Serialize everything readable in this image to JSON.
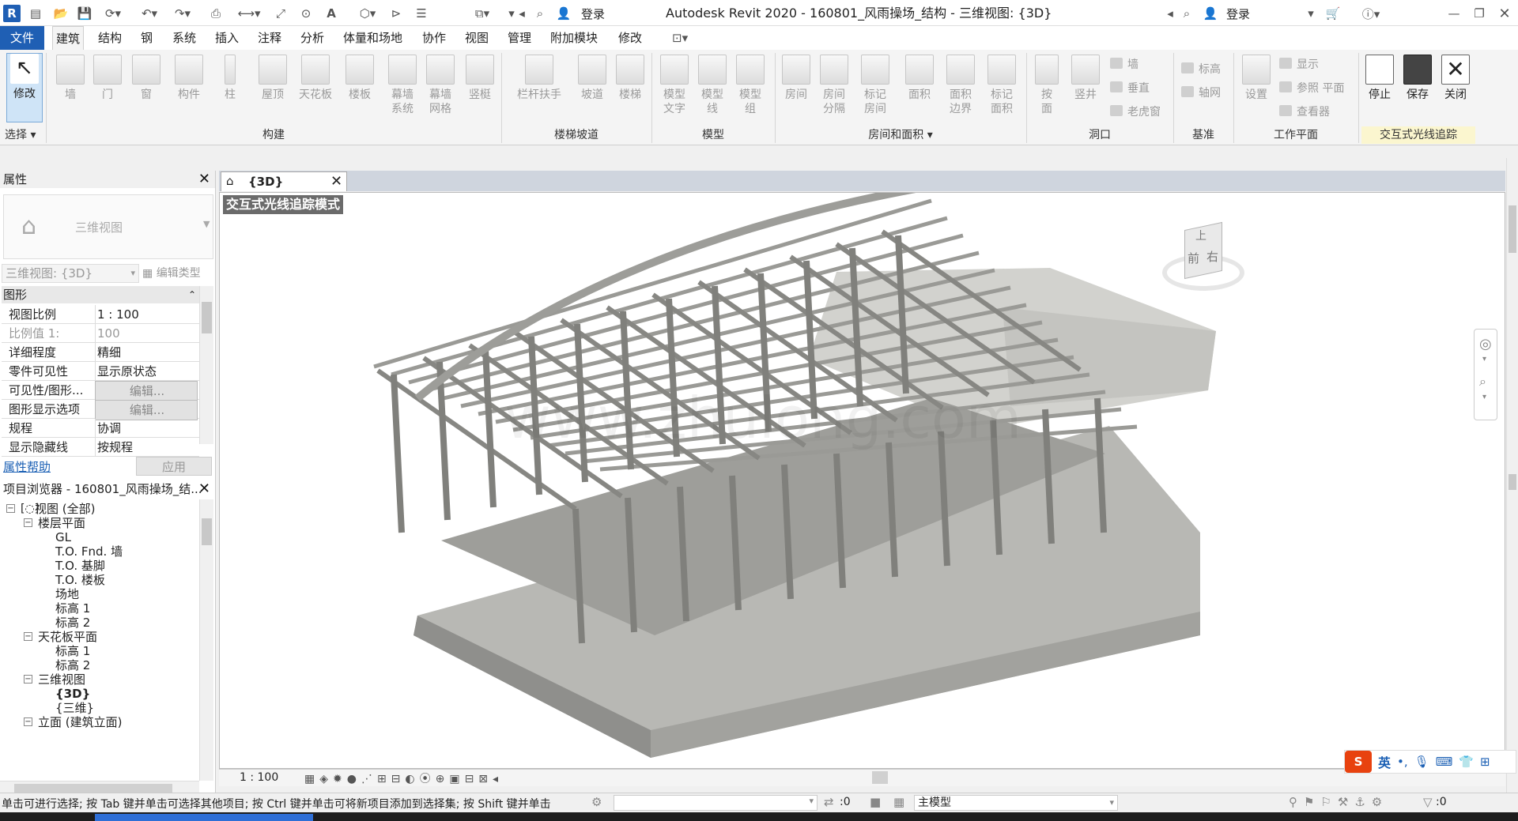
{
  "title_bar": {
    "title": "Autodesk Revit 2020 - 160801_风雨操场_结构 - 三维视图: {3D}",
    "login": "登录",
    "login_right": "登录"
  },
  "menu": [
    "文件",
    "建筑",
    "结构",
    "钢",
    "系统",
    "插入",
    "注释",
    "分析",
    "体量和场地",
    "协作",
    "视图",
    "管理",
    "附加模块",
    "修改"
  ],
  "ribbon": {
    "buttons": [
      {
        "label": "修改",
        "dark": true
      },
      {
        "label": "墙"
      },
      {
        "label": "门"
      },
      {
        "label": "窗"
      },
      {
        "label": "构件"
      },
      {
        "label": "柱"
      },
      {
        "label": "屋顶"
      },
      {
        "label": "天花板"
      },
      {
        "label": "楼板"
      },
      {
        "label": "幕墙\n系统"
      },
      {
        "label": "幕墙\n网格"
      },
      {
        "label": "竖梃"
      },
      {
        "label": "栏杆扶手"
      },
      {
        "label": "坡道"
      },
      {
        "label": "楼梯"
      },
      {
        "label": "模型\n文字"
      },
      {
        "label": "模型\n线"
      },
      {
        "label": "模型\n组"
      },
      {
        "label": "房间"
      },
      {
        "label": "房间\n分隔"
      },
      {
        "label": "标记\n房间"
      },
      {
        "label": "面积"
      },
      {
        "label": "面积\n边界"
      },
      {
        "label": "标记\n面积"
      },
      {
        "label": "按\n面"
      },
      {
        "label": "竖井"
      },
      {
        "label": "设置"
      },
      {
        "label": "停止",
        "dark": true
      },
      {
        "label": "保存",
        "dark": true
      },
      {
        "label": "关闭",
        "dark": true
      }
    ],
    "small": [
      "墙",
      "垂直",
      "老虎窗",
      "标高",
      "轴网",
      "显示",
      "参照 平面",
      "查看器"
    ],
    "panels": [
      "选择",
      "构建",
      "楼梯坡道",
      "模型",
      "房间和面积",
      "洞口",
      "基准",
      "工作平面",
      "交互式光线追踪"
    ]
  },
  "properties": {
    "title": "属性",
    "type_name": "三维视图",
    "type_selector": "三维视图: {3D}",
    "edit_type": "编辑类型",
    "group": "图形",
    "rows": [
      {
        "k": "视图比例",
        "v": "1 : 100"
      },
      {
        "k": "比例值 1:",
        "v": "100",
        "dim": true
      },
      {
        "k": "详细程度",
        "v": "精细"
      },
      {
        "k": "零件可见性",
        "v": "显示原状态"
      },
      {
        "k": "可见性/图形...",
        "v": "编辑...",
        "btn": true
      },
      {
        "k": "图形显示选项",
        "v": "编辑...",
        "btn": true
      },
      {
        "k": "规程",
        "v": "协调"
      },
      {
        "k": "显示隐藏线",
        "v": "按规程"
      }
    ],
    "help": "属性帮助",
    "apply": "应用"
  },
  "browser": {
    "title": "项目浏览器 - 160801_风雨操场_结...",
    "items": [
      {
        "t": "视图 (全部)",
        "lvl": 0,
        "box": "−"
      },
      {
        "t": "楼层平面",
        "lvl": 1,
        "box": "−"
      },
      {
        "t": "GL",
        "lvl": 2
      },
      {
        "t": "T.O. Fnd. 墙",
        "lvl": 2
      },
      {
        "t": "T.O. 基脚",
        "lvl": 2
      },
      {
        "t": "T.O. 楼板",
        "lvl": 2
      },
      {
        "t": "场地",
        "lvl": 2
      },
      {
        "t": "标高 1",
        "lvl": 2
      },
      {
        "t": "标高 2",
        "lvl": 2
      },
      {
        "t": "天花板平面",
        "lvl": 1,
        "box": "−"
      },
      {
        "t": "标高 1",
        "lvl": 2
      },
      {
        "t": "标高 2",
        "lvl": 2
      },
      {
        "t": "三维视图",
        "lvl": 1,
        "box": "−"
      },
      {
        "t": "{3D}",
        "lvl": 2,
        "bold": true
      },
      {
        "t": "{三维}",
        "lvl": 2
      },
      {
        "t": "立面 (建筑立面)",
        "lvl": 1,
        "box": "−"
      }
    ]
  },
  "view": {
    "tab": "{3D}",
    "mode_label": "交互式光线追踪模式",
    "watermark": "www.zhulong.com",
    "scale": "1 : 100",
    "cube_top": "上",
    "cube_front": "前",
    "cube_right": "右"
  },
  "status": {
    "text": "单击可进行选择; 按 Tab 键并单击可选择其他项目; 按 Ctrl 键并单击可将新项目添加到选择集; 按 Shift 键并单击",
    "filter_count": ":0",
    "filter_right": ":0",
    "model": "主模型"
  },
  "ime": {
    "lang": "英"
  }
}
